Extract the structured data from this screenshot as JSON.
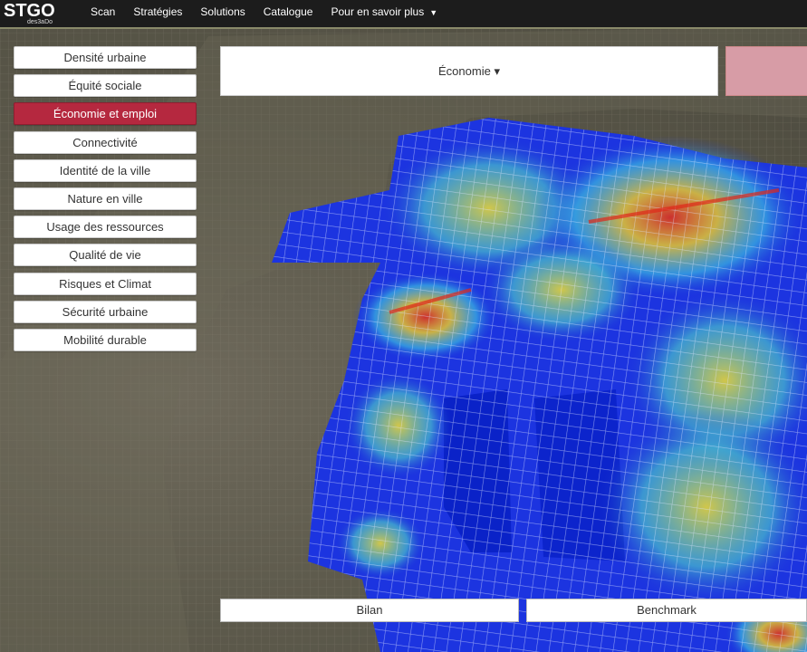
{
  "logo": {
    "main": "STGO",
    "sub": "des3aDo"
  },
  "nav": {
    "items": [
      "Scan",
      "Stratégies",
      "Solutions",
      "Catalogue",
      "Pour en savoir plus"
    ]
  },
  "sidebar": {
    "items": [
      {
        "label": "Densité urbaine",
        "active": false
      },
      {
        "label": "Équité sociale",
        "active": false
      },
      {
        "label": "Économie et emploi",
        "active": true
      },
      {
        "label": "Connectivité",
        "active": false
      },
      {
        "label": "Identité de la ville",
        "active": false
      },
      {
        "label": "Nature en ville",
        "active": false
      },
      {
        "label": "Usage des ressources",
        "active": false
      },
      {
        "label": "Qualité de vie",
        "active": false
      },
      {
        "label": "Risques et Climat",
        "active": false
      },
      {
        "label": "Sécurité urbaine",
        "active": false
      },
      {
        "label": "Mobilité durable",
        "active": false
      }
    ]
  },
  "dropdown": {
    "label": "Économie",
    "caret": "▾"
  },
  "bottom": {
    "bilan": "Bilan",
    "benchmark": "Benchmark"
  },
  "colors": {
    "accent": "#b5283f",
    "heat_low": "#1a2fd6",
    "heat_high": "#e02a1a"
  }
}
